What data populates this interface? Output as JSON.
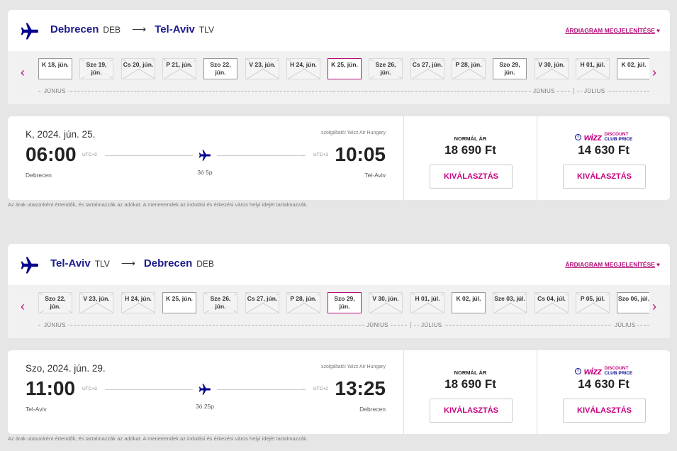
{
  "outbound": {
    "route": {
      "origin_city": "Debrecen",
      "origin_code": "DEB",
      "destination_city": "Tel-Aviv",
      "destination_code": "TLV",
      "chart_link": "ÁRDIAGRAM MEGJELENÍTÉSE"
    },
    "days": [
      {
        "label": "K 18, jún.",
        "state": "avail"
      },
      {
        "label": "Sze 19, jún.",
        "state": "nf"
      },
      {
        "label": "Cs 20, jún.",
        "state": "nf"
      },
      {
        "label": "P 21, jún.",
        "state": "nf"
      },
      {
        "label": "Szo 22, jún.",
        "state": "avail"
      },
      {
        "label": "V 23, jún.",
        "state": "nf"
      },
      {
        "label": "H 24, jún.",
        "state": "nf"
      },
      {
        "label": "K 25, jún.",
        "state": "selected"
      },
      {
        "label": "Sze 26, jún.",
        "state": "nf"
      },
      {
        "label": "Cs 27, jún.",
        "state": "nf"
      },
      {
        "label": "P 28, jún.",
        "state": "nf"
      },
      {
        "label": "Szo 29, jún.",
        "state": "avail"
      },
      {
        "label": "V 30, jún.",
        "state": "nf"
      },
      {
        "label": "H 01, júl.",
        "state": "nf"
      },
      {
        "label": "K 02, júl.",
        "state": "avail"
      }
    ],
    "months": [
      "JÚNIUS",
      "JÚNIUS",
      "JÚLIUS"
    ],
    "flight": {
      "date": "K, 2024. jún. 25.",
      "operator": "szolgáltató: Wizz Air Hungary",
      "dep_time": "06:00",
      "dep_utc": "UTC+2",
      "dep_place": "Debrecen",
      "arr_time": "10:05",
      "arr_utc": "UTC+3",
      "arr_place": "Tel-Aviv",
      "duration": "3ó 5p"
    },
    "fares": {
      "normal_label": "NORMÁL ÁR",
      "normal_price": "18 690 Ft",
      "club_logo_wizz": "wizz",
      "club_logo_line1": "DISCOUNT",
      "club_logo_line2": "CLUB PRICE",
      "club_price": "14 630 Ft",
      "select_label": "KIVÁLASZTÁS"
    },
    "footnote": "Az árak utasonként értendők, és tartalmazzák az adókat. A menetrendek az indulási és érkezési város helyi idejét tartalmazzák."
  },
  "return": {
    "route": {
      "origin_city": "Tel-Aviv",
      "origin_code": "TLV",
      "destination_city": "Debrecen",
      "destination_code": "DEB",
      "chart_link": "ÁRDIAGRAM MEGJELENÍTÉSE"
    },
    "days": [
      {
        "label": "Szo 22, jún.",
        "state": "nf"
      },
      {
        "label": "V 23, jún.",
        "state": "nf"
      },
      {
        "label": "H 24, jún.",
        "state": "nf"
      },
      {
        "label": "K 25, jún.",
        "state": "avail"
      },
      {
        "label": "Sze 26, jún.",
        "state": "nf"
      },
      {
        "label": "Cs 27, jún.",
        "state": "nf"
      },
      {
        "label": "P 28, jún.",
        "state": "nf"
      },
      {
        "label": "Szo 29, jún.",
        "state": "selected"
      },
      {
        "label": "V 30, jún.",
        "state": "nf"
      },
      {
        "label": "H 01, júl.",
        "state": "nf"
      },
      {
        "label": "K 02, júl.",
        "state": "avail"
      },
      {
        "label": "Sze 03, júl.",
        "state": "nf"
      },
      {
        "label": "Cs 04, júl.",
        "state": "nf"
      },
      {
        "label": "P 05, júl.",
        "state": "nf"
      },
      {
        "label": "Szo 06, júl.",
        "state": "avail"
      }
    ],
    "months": [
      "JÚNIUS",
      "JÚNIUS",
      "JÚLIUS",
      "JÚLIUS"
    ],
    "flight": {
      "date": "Szo, 2024. jún. 29.",
      "operator": "szolgáltató: Wizz Air Hungary",
      "dep_time": "11:00",
      "dep_utc": "UTC+3",
      "dep_place": "Tel-Aviv",
      "arr_time": "13:25",
      "arr_utc": "UTC+2",
      "arr_place": "Debrecen",
      "duration": "3ó 25p"
    },
    "fares": {
      "normal_label": "NORMÁL ÁR",
      "normal_price": "18 690 Ft",
      "club_logo_wizz": "wizz",
      "club_logo_line1": "DISCOUNT",
      "club_logo_line2": "CLUB PRICE",
      "club_price": "14 630 Ft",
      "select_label": "KIVÁLASZTÁS"
    },
    "footnote": "Az árak utasonként értendők, és tartalmazzák az adókat. A menetrendek az indulási és érkezési város helyi idejét tartalmazzák."
  },
  "colors": {
    "brand_blue": "#06038d",
    "brand_magenta": "#c6007e",
    "page_bg": "#e6e6e6"
  },
  "icons": {
    "airline": "plane-icon",
    "prev": "chevron-left-icon",
    "next": "chevron-right-icon",
    "info": "info-icon",
    "favorite": "heart-icon"
  }
}
